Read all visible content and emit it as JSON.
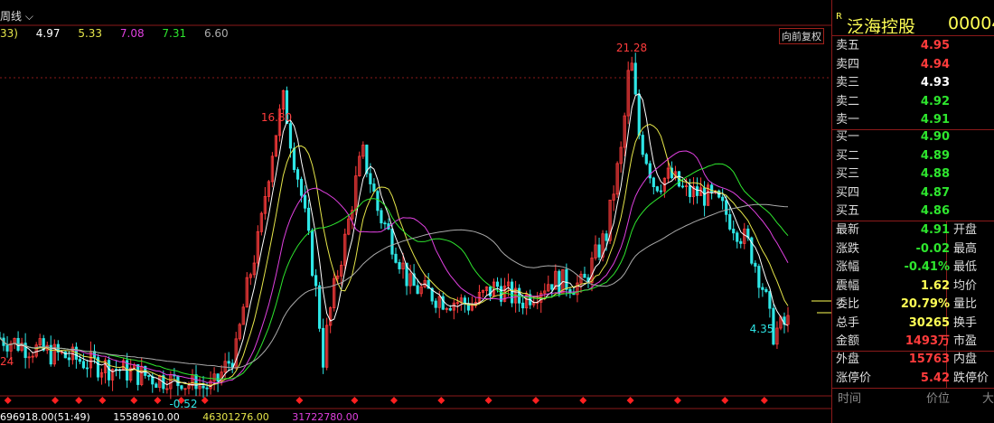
{
  "toolbar": {
    "period_label": "周线",
    "ma_prefix": "33)",
    "ma_values": [
      {
        "value": "4.97",
        "color": "#ffffff"
      },
      {
        "value": "5.33",
        "color": "#e6e64a"
      },
      {
        "value": "7.08",
        "color": "#e040e0"
      },
      {
        "value": "7.31",
        "color": "#2ee62e"
      },
      {
        "value": "6.60",
        "color": "#aaaaaa"
      }
    ],
    "adjust_badge": "向前复权"
  },
  "chart_data": {
    "type": "candlestick",
    "annotations": [
      {
        "text": "21.28",
        "kind": "max"
      },
      {
        "text": "16.80",
        "kind": "local-high"
      },
      {
        "text": "4.35",
        "kind": "recent-low"
      },
      {
        "text": "-0.52",
        "kind": "min"
      },
      {
        "text": "24",
        "kind": "left-edge-label"
      }
    ],
    "price_peaks": [
      21.28,
      16.8,
      4.35
    ],
    "grid": true
  },
  "volume_bar": {
    "values": [
      {
        "text": "696918.00(51:49)",
        "color": "#ffffff"
      },
      {
        "text": "15589610.00",
        "color": "#ffffff"
      },
      {
        "text": "46301276.00",
        "color": "#e6e64a"
      },
      {
        "text": "31722780.00",
        "color": "#e040e0"
      }
    ]
  },
  "stock": {
    "r_mark": "R",
    "name": "泛海控股",
    "code": "00004"
  },
  "order_book": {
    "sells": [
      {
        "label": "卖五",
        "price": "4.95",
        "color": "#ff3c3c"
      },
      {
        "label": "卖四",
        "price": "4.94",
        "color": "#ff3c3c"
      },
      {
        "label": "卖三",
        "price": "4.93",
        "color": "#ffffff"
      },
      {
        "label": "卖二",
        "price": "4.92",
        "color": "#2ee62e"
      },
      {
        "label": "卖一",
        "price": "4.91",
        "color": "#2ee62e"
      }
    ],
    "buys": [
      {
        "label": "买一",
        "price": "4.90",
        "color": "#2ee62e"
      },
      {
        "label": "买二",
        "price": "4.89",
        "color": "#2ee62e"
      },
      {
        "label": "买三",
        "price": "4.88",
        "color": "#2ee62e"
      },
      {
        "label": "买四",
        "price": "4.87",
        "color": "#2ee62e"
      },
      {
        "label": "买五",
        "price": "4.86",
        "color": "#2ee62e"
      }
    ]
  },
  "quote": [
    {
      "label": "最新",
      "value": "4.91",
      "color": "#2ee62e",
      "label2": "开盘"
    },
    {
      "label": "涨跌",
      "value": "-0.02",
      "color": "#2ee62e",
      "label2": "最高"
    },
    {
      "label": "涨幅",
      "value": "-0.41%",
      "color": "#2ee62e",
      "label2": "最低"
    },
    {
      "label": "震幅",
      "value": "1.62",
      "color": "#ffff55",
      "label2": "均价"
    },
    {
      "label": "委比",
      "value": "20.79%",
      "color": "#ffff55",
      "label2": "量比"
    },
    {
      "label": "总手",
      "value": "30265",
      "color": "#ffff55",
      "label2": "换手"
    },
    {
      "label": "金额",
      "value": "1493万",
      "color": "#ff3c3c",
      "label2": "市盈"
    }
  ],
  "quote2": [
    {
      "label": "外盘",
      "value": "15763",
      "color": "#ff3c3c",
      "label2": "内盘"
    },
    {
      "label": "涨停价",
      "value": "5.42",
      "color": "#ff3c3c",
      "label2": "跌停价"
    }
  ],
  "footer": {
    "time": "时间",
    "price": "价位",
    "big": "大"
  },
  "colors": {
    "up": "#ff3c3c",
    "down": "#2ee6e6",
    "ma5": "#ffffff",
    "ma10": "#e6e64a",
    "ma20": "#e040e0",
    "ma30": "#2ee62e",
    "ma60": "#aaaaaa",
    "border": "#8b1a1a"
  }
}
